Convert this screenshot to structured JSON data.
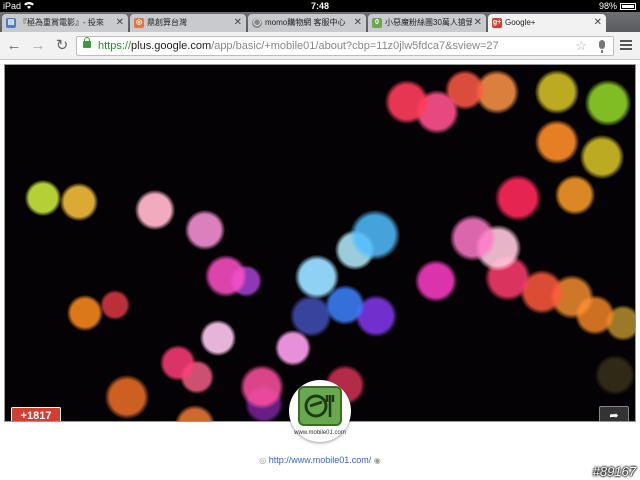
{
  "status_bar": {
    "device": "iPad",
    "time": "7:48",
    "battery": "98%"
  },
  "tabs": [
    {
      "title": "『極為重賞電影』- 投來",
      "favicon": "page-icon",
      "favicon_color": "#4a7fc1",
      "active": false
    },
    {
      "title": "鼎創算台灣",
      "favicon": "orange-icon",
      "favicon_color": "#e8743b",
      "active": false
    },
    {
      "title": "momo購物網 客服中心",
      "favicon": "globe-icon",
      "favicon_color": "#888888",
      "active": false
    },
    {
      "title": "小惡魔粉絲團30萬人搶頭",
      "favicon": "m01-icon",
      "favicon_color": "#6aa84f",
      "active": false
    },
    {
      "title": "Google+",
      "favicon": "gplus-icon",
      "favicon_color": "#d23f31",
      "active": true
    }
  ],
  "toolbar": {
    "url_scheme": "https://",
    "url_host": "plus.google.com",
    "url_path": "/app/basic/+mobile01/about?cbp=11z0jlw5fdca7&sview=27"
  },
  "profile": {
    "plus_count": "+1817",
    "avatar_caption": "www.mobile01.com",
    "link": "http://www.mobile01.com/"
  },
  "watermark": "#89167",
  "colors": {
    "gplus_red": "#d23f31",
    "link_blue": "#3366cc",
    "secure_green": "#2e8b2e"
  }
}
